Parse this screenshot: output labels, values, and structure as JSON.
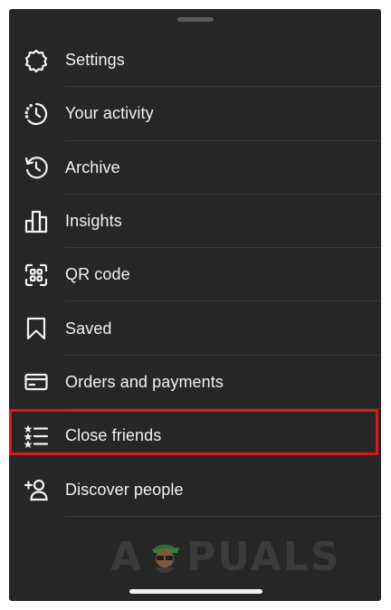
{
  "menu": {
    "items": [
      {
        "label": "Settings",
        "icon": "settings-gear-icon"
      },
      {
        "label": "Your activity",
        "icon": "activity-clock-icon"
      },
      {
        "label": "Archive",
        "icon": "archive-history-icon"
      },
      {
        "label": "Insights",
        "icon": "insights-bar-chart-icon"
      },
      {
        "label": "QR code",
        "icon": "qr-code-icon"
      },
      {
        "label": "Saved",
        "icon": "bookmark-icon"
      },
      {
        "label": "Orders and payments",
        "icon": "credit-card-icon"
      },
      {
        "label": "Close friends",
        "icon": "close-friends-star-list-icon"
      },
      {
        "label": "Discover people",
        "icon": "add-person-icon"
      }
    ],
    "highlighted_item": "Close friends"
  },
  "watermark": {
    "left": "A",
    "right": "PUALS"
  },
  "colors": {
    "sheet_background": "#262626",
    "text": "#f2f2f2",
    "highlight": "#e3141b",
    "divider": "#3a3a3a"
  }
}
